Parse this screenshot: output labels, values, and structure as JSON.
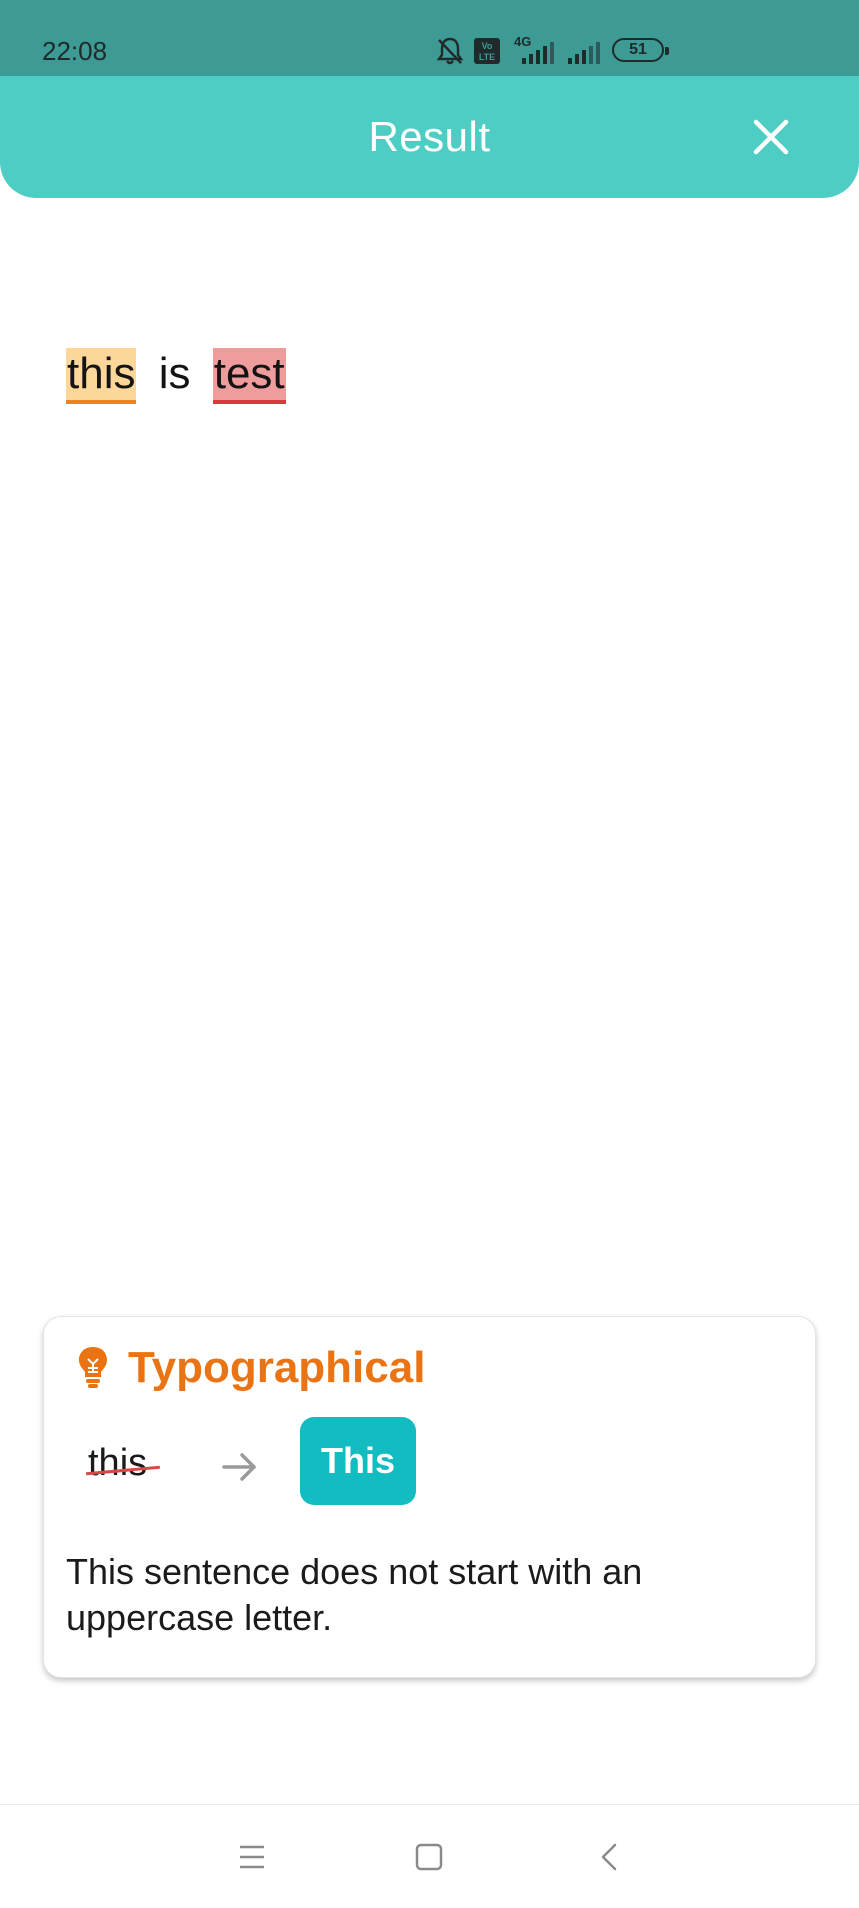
{
  "status_bar": {
    "time": "22:08",
    "battery": "51",
    "network": "4G",
    "icons": [
      "bell-off-icon",
      "volte-icon",
      "signal-icon",
      "signal-icon",
      "battery-icon"
    ]
  },
  "header": {
    "title": "Result",
    "close_icon": "close-icon",
    "background": "#4ecdc4"
  },
  "text": {
    "words": [
      "this",
      "is",
      "test"
    ]
  },
  "suggestion": {
    "category": "Typographical",
    "category_color": "#ea7414",
    "icon": "lightbulb-icon",
    "original": "this",
    "replacement": "This",
    "replacement_color": "#13bcc1",
    "message": "This sentence does not start with an uppercase letter."
  },
  "nav": {
    "items": [
      "menu-icon",
      "home-icon",
      "back-icon"
    ]
  }
}
